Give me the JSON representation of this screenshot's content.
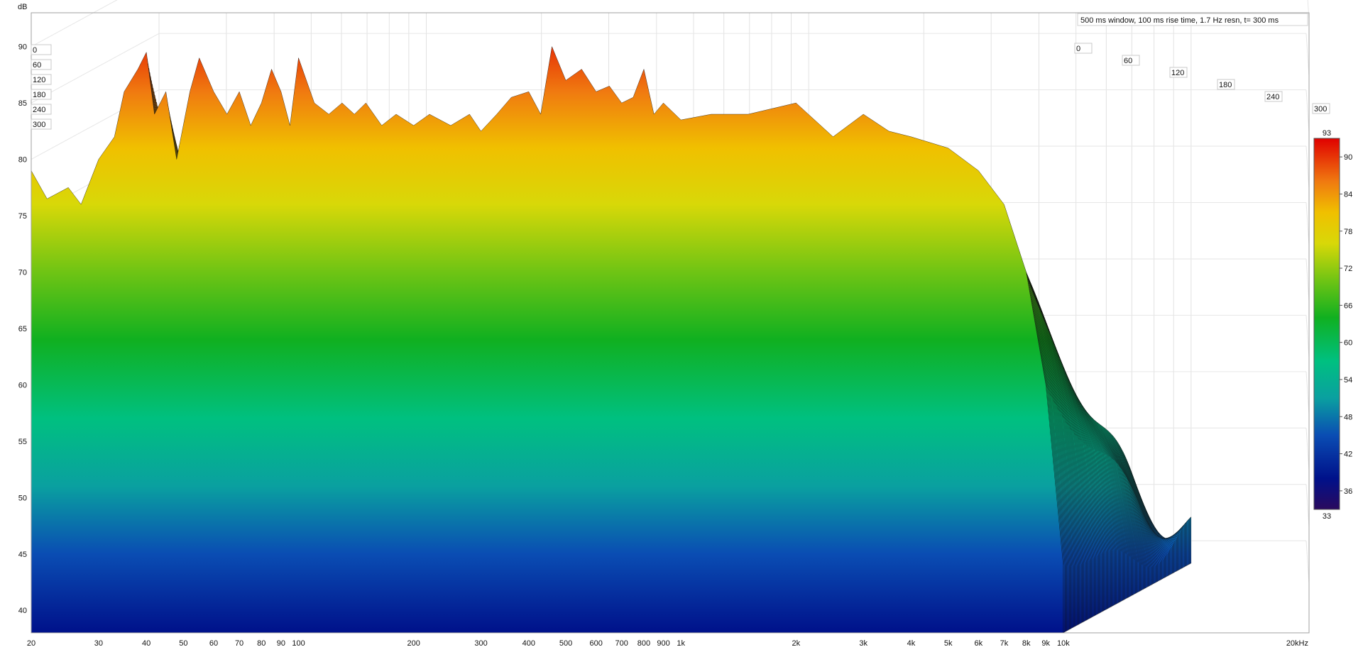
{
  "chart_data": {
    "type": "area",
    "subtype": "waterfall",
    "annotation": "500 ms window, 100 ms rise time,  1.7 Hz resn, t= 300 ms",
    "y_unit_label": "dB",
    "x_unit_label": "20kHz",
    "x_scale": "log",
    "xlim": [
      20,
      20000
    ],
    "ylim": [
      38,
      93
    ],
    "grid": true,
    "x_ticks": [
      {
        "value": 20,
        "label": "20"
      },
      {
        "value": 30,
        "label": "30"
      },
      {
        "value": 40,
        "label": "40"
      },
      {
        "value": 50,
        "label": "50"
      },
      {
        "value": 60,
        "label": "60"
      },
      {
        "value": 70,
        "label": "70"
      },
      {
        "value": 80,
        "label": "80"
      },
      {
        "value": 90,
        "label": "90"
      },
      {
        "value": 100,
        "label": "100"
      },
      {
        "value": 200,
        "label": "200"
      },
      {
        "value": 300,
        "label": "300"
      },
      {
        "value": 400,
        "label": "400"
      },
      {
        "value": 500,
        "label": "500"
      },
      {
        "value": 600,
        "label": "600"
      },
      {
        "value": 700,
        "label": "700"
      },
      {
        "value": 800,
        "label": "800"
      },
      {
        "value": 900,
        "label": "900"
      },
      {
        "value": 1000,
        "label": "1k"
      },
      {
        "value": 2000,
        "label": "2k"
      },
      {
        "value": 3000,
        "label": "3k"
      },
      {
        "value": 4000,
        "label": "4k"
      },
      {
        "value": 5000,
        "label": "5k"
      },
      {
        "value": 6000,
        "label": "6k"
      },
      {
        "value": 7000,
        "label": "7k"
      },
      {
        "value": 8000,
        "label": "8k"
      },
      {
        "value": 9000,
        "label": "9k"
      },
      {
        "value": 10000,
        "label": "10k"
      }
    ],
    "y_ticks": [
      40,
      45,
      50,
      55,
      60,
      65,
      70,
      75,
      80,
      85,
      90
    ],
    "time_ticks_ms": [
      0,
      60,
      120,
      180,
      240,
      300
    ],
    "time_slice_count": 150,
    "front_slice": {
      "x_hz": [
        20,
        22,
        25,
        27,
        30,
        33,
        35,
        38,
        40,
        42,
        45,
        48,
        52,
        55,
        60,
        65,
        70,
        75,
        80,
        85,
        90,
        95,
        100,
        110,
        120,
        130,
        140,
        150,
        165,
        180,
        200,
        220,
        250,
        280,
        300,
        330,
        360,
        400,
        430,
        460,
        500,
        550,
        600,
        650,
        700,
        750,
        800,
        850,
        900,
        1000,
        1200,
        1500,
        2000,
        2500,
        3000,
        3500,
        4000,
        5000,
        6000,
        7000,
        8000,
        9000,
        10000
      ],
      "y_db": [
        79,
        76.5,
        77.5,
        76,
        80,
        82,
        86,
        88,
        89.5,
        84,
        86,
        80,
        86,
        89,
        86,
        84,
        86,
        83,
        85,
        88,
        86,
        83,
        89,
        85,
        84,
        85,
        84,
        85,
        83,
        84,
        83,
        84,
        83,
        84,
        82.5,
        84,
        85.5,
        86,
        84,
        90,
        87,
        88,
        86,
        86.5,
        85,
        85.5,
        88,
        84,
        85,
        83.5,
        84,
        84,
        85,
        82,
        84,
        82.5,
        82,
        81,
        79,
        76,
        70,
        60,
        44
      ]
    },
    "tail_slice_y_db": [
      49,
      45,
      47,
      45,
      48,
      52,
      49,
      44,
      46,
      48,
      44,
      52,
      48,
      47,
      55,
      50,
      48,
      46,
      52,
      45,
      49,
      47,
      56,
      52,
      49,
      53,
      50,
      51,
      49,
      53,
      48,
      50,
      52,
      49,
      53,
      47,
      51,
      50,
      48,
      52,
      49,
      51,
      48,
      50,
      47,
      51,
      49,
      48,
      50,
      49,
      49,
      48,
      48,
      47,
      47,
      46,
      46,
      45,
      44,
      43,
      42,
      41,
      40
    ],
    "colorbar": {
      "min_label": "33",
      "max_label": "93",
      "tick_labels": [
        "90",
        "84",
        "78",
        "72",
        "66",
        "60",
        "54",
        "48",
        "42",
        "36"
      ],
      "stops": [
        {
          "db": 33,
          "color": "#2a0a5e"
        },
        {
          "db": 38,
          "color": "#00118a"
        },
        {
          "db": 45,
          "color": "#0a4db3"
        },
        {
          "db": 51,
          "color": "#0aa0a0"
        },
        {
          "db": 57,
          "color": "#00c080"
        },
        {
          "db": 64,
          "color": "#10b020"
        },
        {
          "db": 70,
          "color": "#6fc414"
        },
        {
          "db": 76,
          "color": "#d8d808"
        },
        {
          "db": 81,
          "color": "#f0c000"
        },
        {
          "db": 86,
          "color": "#f07a10"
        },
        {
          "db": 93,
          "color": "#e00000"
        }
      ]
    }
  }
}
